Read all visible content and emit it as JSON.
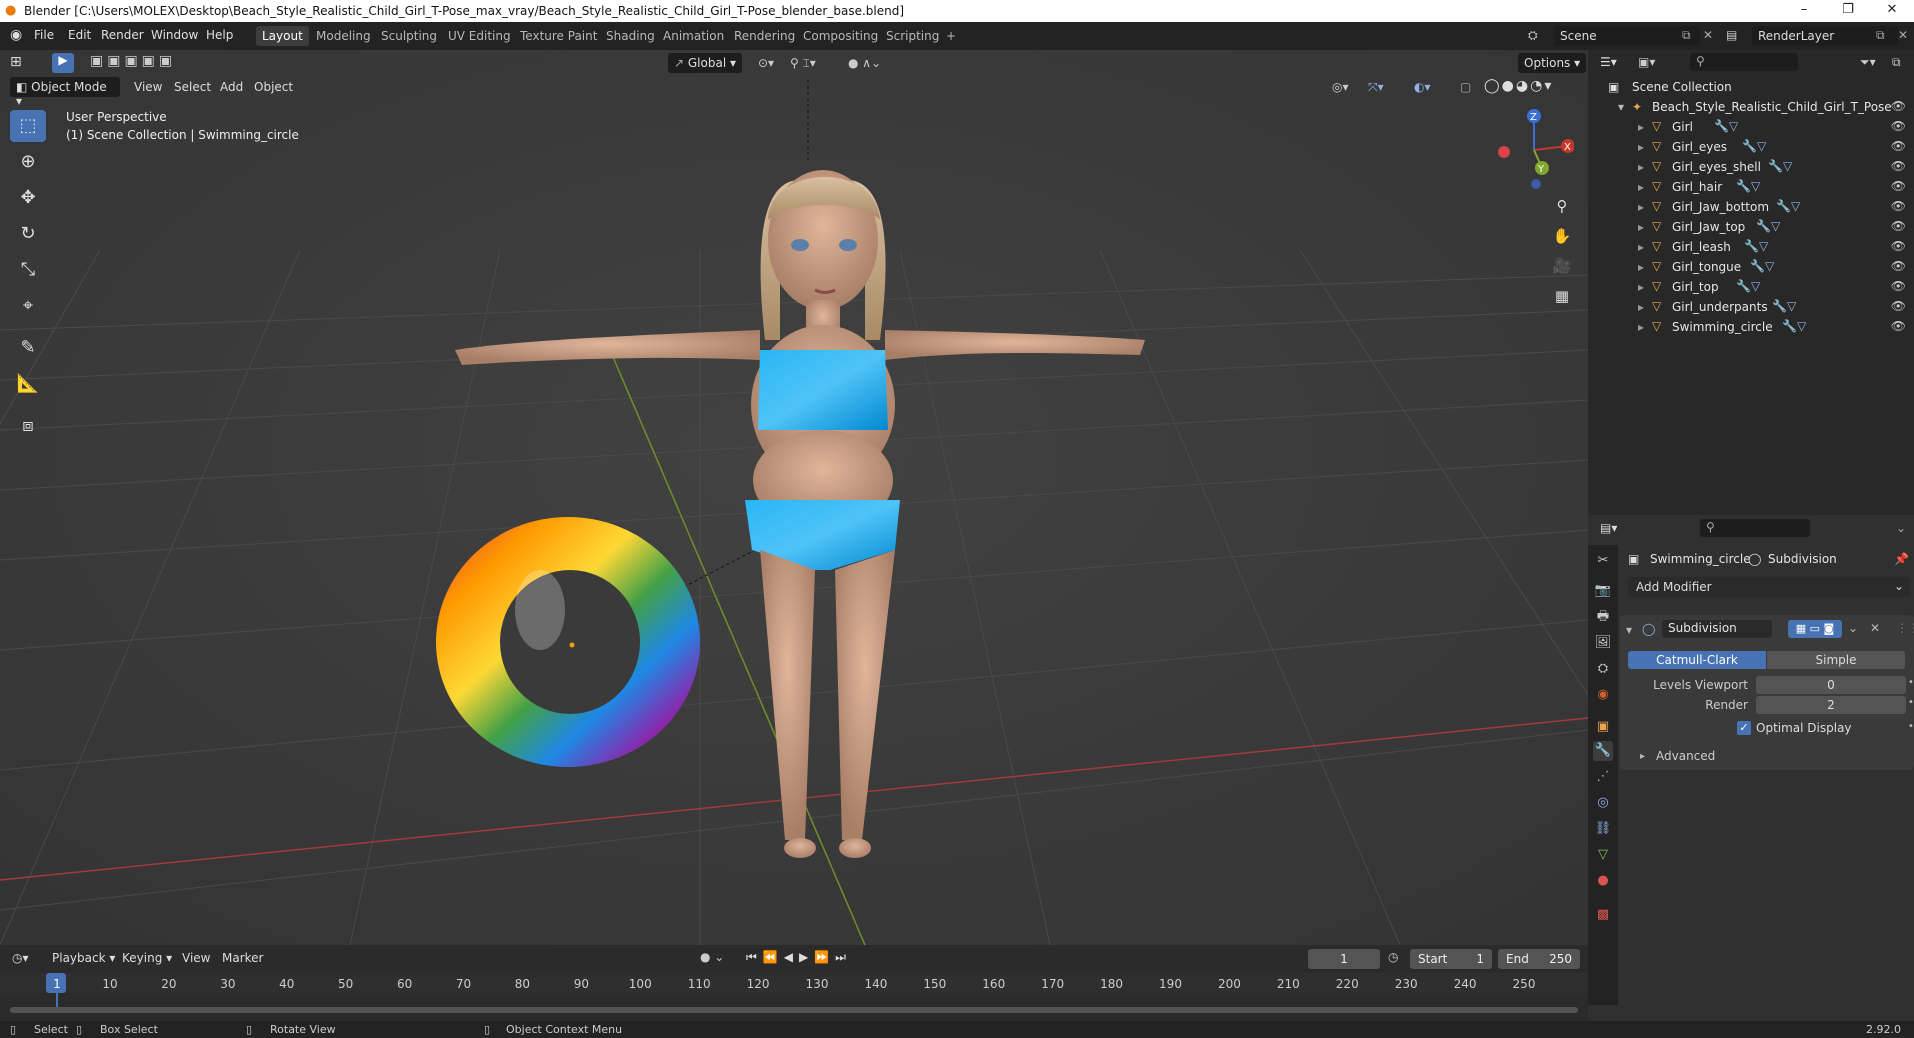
{
  "window": {
    "title": "Blender [C:\\Users\\MOLEX\\Desktop\\Beach_Style_Realistic_Child_Girl_T-Pose_max_vray/Beach_Style_Realistic_Child_Girl_T-Pose_blender_base.blend]"
  },
  "menus": [
    "File",
    "Edit",
    "Render",
    "Window",
    "Help"
  ],
  "workspaces": [
    "Layout",
    "Modeling",
    "Sculpting",
    "UV Editing",
    "Texture Paint",
    "Shading",
    "Animation",
    "Rendering",
    "Compositing",
    "Scripting"
  ],
  "active_workspace": "Layout",
  "scene": {
    "name": "Scene",
    "render_layer": "RenderLayer"
  },
  "viewport": {
    "orientation": "Global",
    "options_label": "Options",
    "mode": "Object Mode",
    "menus": [
      "View",
      "Select",
      "Add",
      "Object"
    ],
    "perspective": "User Perspective",
    "collection_info": "(1) Scene Collection | Swimming_circle"
  },
  "outliner": {
    "root": "Scene Collection",
    "collection": "Beach_Style_Realistic_Child_Girl_T_Pose",
    "objects": [
      "Girl",
      "Girl_eyes",
      "Girl_eyes_shell",
      "Girl_hair",
      "Girl_Jaw_bottom",
      "Girl_Jaw_top",
      "Girl_leash",
      "Girl_tongue",
      "Girl_top",
      "Girl_underpants",
      "Swimming_circle"
    ]
  },
  "properties": {
    "object": "Swimming_circle",
    "modifier_context": "Subdivision",
    "add_modifier": "Add Modifier",
    "modifier_name": "Subdivision",
    "algorithms": [
      "Catmull-Clark",
      "Simple"
    ],
    "active_algorithm": "Catmull-Clark",
    "levels_viewport_label": "Levels Viewport",
    "levels_viewport": "0",
    "render_label": "Render",
    "render_levels": "2",
    "optimal_display": "Optimal Display",
    "optimal_display_checked": true,
    "advanced": "Advanced"
  },
  "timeline": {
    "menus": [
      "Playback",
      "Keying",
      "View",
      "Marker"
    ],
    "current_frame": "1",
    "start_label": "Start",
    "start": "1",
    "end_label": "End",
    "end": "250",
    "ticks": [
      "1",
      "10",
      "20",
      "30",
      "40",
      "50",
      "60",
      "70",
      "80",
      "90",
      "100",
      "110",
      "120",
      "130",
      "140",
      "150",
      "160",
      "170",
      "180",
      "190",
      "200",
      "210",
      "220",
      "230",
      "240",
      "250"
    ]
  },
  "statusbar": {
    "select": "Select",
    "box_select": "Box Select",
    "rotate_view": "Rotate View",
    "context_menu": "Object Context Menu",
    "version": "2.92.0"
  },
  "colors": {
    "accent": "#4772b3",
    "header": "#232323",
    "viewport_bg": "#3b3b3b",
    "x_axis": "#c0392b",
    "y_axis": "#7fa82a",
    "playhead": "#4772b3"
  },
  "icons": [
    "blender-logo-icon",
    "select-box-icon",
    "cursor-icon",
    "move-icon",
    "rotate-icon",
    "scale-icon",
    "transform-icon",
    "annotate-icon",
    "measure-icon",
    "add-cube-icon",
    "eye-icon",
    "wrench-icon",
    "mesh-icon",
    "zoom-icon",
    "hand-icon",
    "camera-icon",
    "grid-icon"
  ]
}
